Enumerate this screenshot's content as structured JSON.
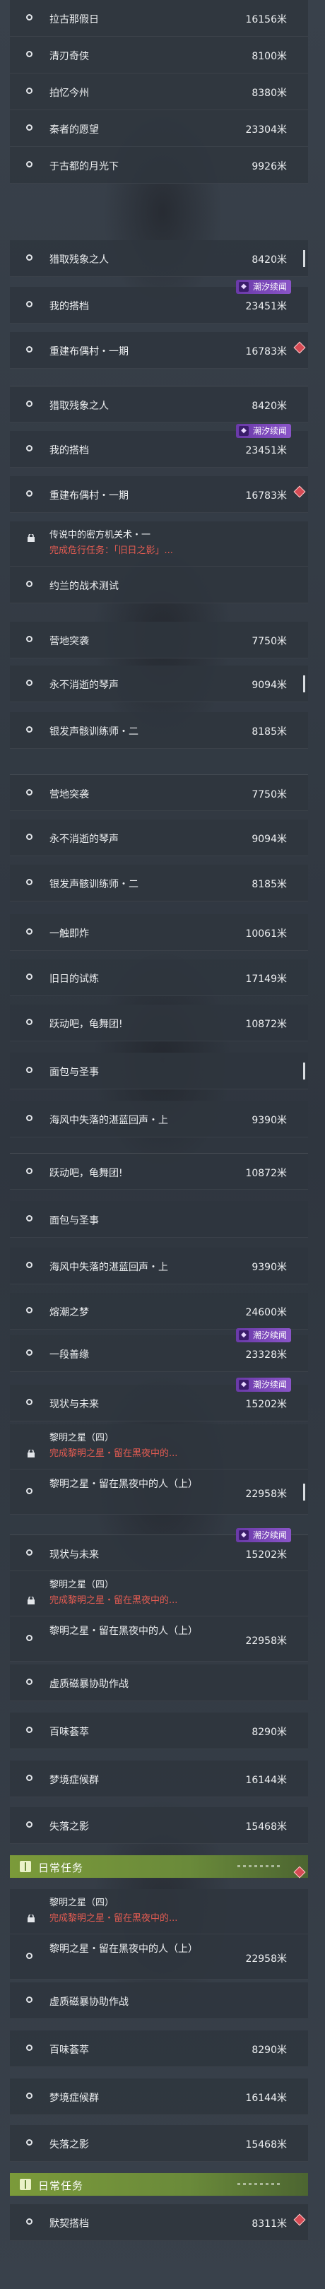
{
  "unit": "米",
  "section_title": "日常任务",
  "badge_label": "潮汐续闻",
  "rows": [
    {
      "title": "拉古那假日",
      "dist": "16156米"
    },
    {
      "title": "清刃奇侠",
      "dist": "8100米"
    },
    {
      "title": "拍忆今州",
      "dist": "8380米"
    },
    {
      "title": "秦者的愿望",
      "dist": "23304米"
    },
    {
      "title": "于古都的月光下",
      "dist": "9926米"
    },
    {
      "title": "猎取残象之人",
      "dist": "8420米"
    },
    {
      "title": "我的搭档",
      "dist": "23451米"
    },
    {
      "title": "重建布偶村・一期",
      "dist": "16783米"
    },
    {
      "title": "猎取残象之人",
      "dist": "8420米"
    },
    {
      "title": "我的搭档",
      "dist": "23451米"
    },
    {
      "title": "重建布偶村・一期",
      "dist": "16783米"
    },
    {
      "title": "传说中的密方机关术・一",
      "sub": "完成危行任务：「旧日之影」..."
    },
    {
      "title": "约兰的战术测试",
      "dist": ""
    },
    {
      "title": "营地突袭",
      "dist": "7750米"
    },
    {
      "title": "永不消逝的琴声",
      "dist": "9094米"
    },
    {
      "title": "银发声骸训练师・二",
      "dist": "8185米"
    },
    {
      "title": "营地突袭",
      "dist": "7750米"
    },
    {
      "title": "永不消逝的琴声",
      "dist": "9094米"
    },
    {
      "title": "银发声骸训练师・二",
      "dist": "8185米"
    },
    {
      "title": "一触即炸",
      "dist": "10061米"
    },
    {
      "title": "旧日的试炼",
      "dist": "17149米"
    },
    {
      "title": "跃动吧，龟舞团!",
      "dist": "10872米"
    },
    {
      "title": "面包与圣事",
      "dist": ""
    },
    {
      "title": "海风中失落的湛蓝回声・上",
      "dist": "9390米"
    },
    {
      "title": "跃动吧，龟舞团!",
      "dist": "10872米"
    },
    {
      "title": "面包与圣事",
      "dist": ""
    },
    {
      "title": "海风中失落的湛蓝回声・上",
      "dist": "9390米"
    },
    {
      "title": "熔潮之梦",
      "dist": "24600米"
    },
    {
      "title": "一段善缘",
      "dist": "23328米"
    },
    {
      "title": "现状与未来",
      "dist": "15202米"
    },
    {
      "title": "黎明之星（四）",
      "sub": "完成黎明之星・留在黑夜中的..."
    },
    {
      "title": "黎明之星・留在黑夜中的人（上）",
      "dist": "22958米"
    },
    {
      "title": "现状与未来",
      "dist": "15202米"
    },
    {
      "title": "黎明之星（四）",
      "sub": "完成黎明之星・留在黑夜中的..."
    },
    {
      "title": "黎明之星・留在黑夜中的人（上）",
      "dist": "22958米"
    },
    {
      "title": "虚质磁暴协助作战",
      "dist": ""
    },
    {
      "title": "百味荟萃",
      "dist": "8290米"
    },
    {
      "title": "梦境症候群",
      "dist": "16144米"
    },
    {
      "title": "失落之影",
      "dist": "15468米"
    },
    {
      "title": "黎明之星（四）",
      "sub": "完成黎明之星・留在黑夜中的..."
    },
    {
      "title": "黎明之星・留在黑夜中的人（上）",
      "dist": "22958米"
    },
    {
      "title": "虚质磁暴协助作战",
      "dist": ""
    },
    {
      "title": "百味荟萃",
      "dist": "8290米"
    },
    {
      "title": "梦境症候群",
      "dist": "16144米"
    },
    {
      "title": "失落之影",
      "dist": "15468米"
    },
    {
      "title": "默契搭档",
      "dist": "8311米"
    }
  ]
}
